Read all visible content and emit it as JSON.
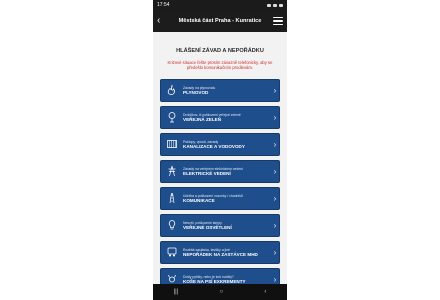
{
  "status": {
    "time": "17:54"
  },
  "header": {
    "title": "Městská část Praha - Kunratice"
  },
  "main": {
    "heading": "HLÁŠENÍ ZÁVAD A NEPOŘÁDKU",
    "notice": "Krizové situace řešte prosím závazně telefonicky, aby se předešlo komunikačním prodlevám.",
    "items": [
      {
        "sub": "Závady na plynovodu",
        "main": "PLYNOVOD",
        "icon": "flame-icon"
      },
      {
        "sub": "Drobílkov, či poškození veřejné zeleně",
        "main": "VEŘEJNÁ ZELEŇ",
        "icon": "tree-icon"
      },
      {
        "sub": "Poklopy, vpusti, závady",
        "main": "KANALIZACE A VODOVODY",
        "icon": "grate-icon"
      },
      {
        "sub": "Závady na veřejném elektrickém vedení",
        "main": "ELEKTRICKÉ VEDENÍ",
        "icon": "power-tower-icon"
      },
      {
        "sub": "Údržba a poškození vozovky / chodníků",
        "main": "KOMUNIKACE",
        "icon": "road-icon"
      },
      {
        "sub": "Nesvítí, poškozené lampy",
        "main": "VEŘEJNÉ OSVĚTLENÍ",
        "icon": "bulb-icon"
      },
      {
        "sub": "Rozbitá zastávka, lavičky a jiné",
        "main": "NEPOŘÁDEK NA ZASTÁVCE MHD",
        "icon": "bus-stop-icon"
      },
      {
        "sub": "Došly pytlíky, nebo je koš rozbitý?",
        "main": "KOŠE NA PSÍ EXKREMENTY",
        "icon": "dog-icon"
      }
    ]
  },
  "colors": {
    "accent": "#1f4e8c",
    "alert": "#d12b2b"
  }
}
